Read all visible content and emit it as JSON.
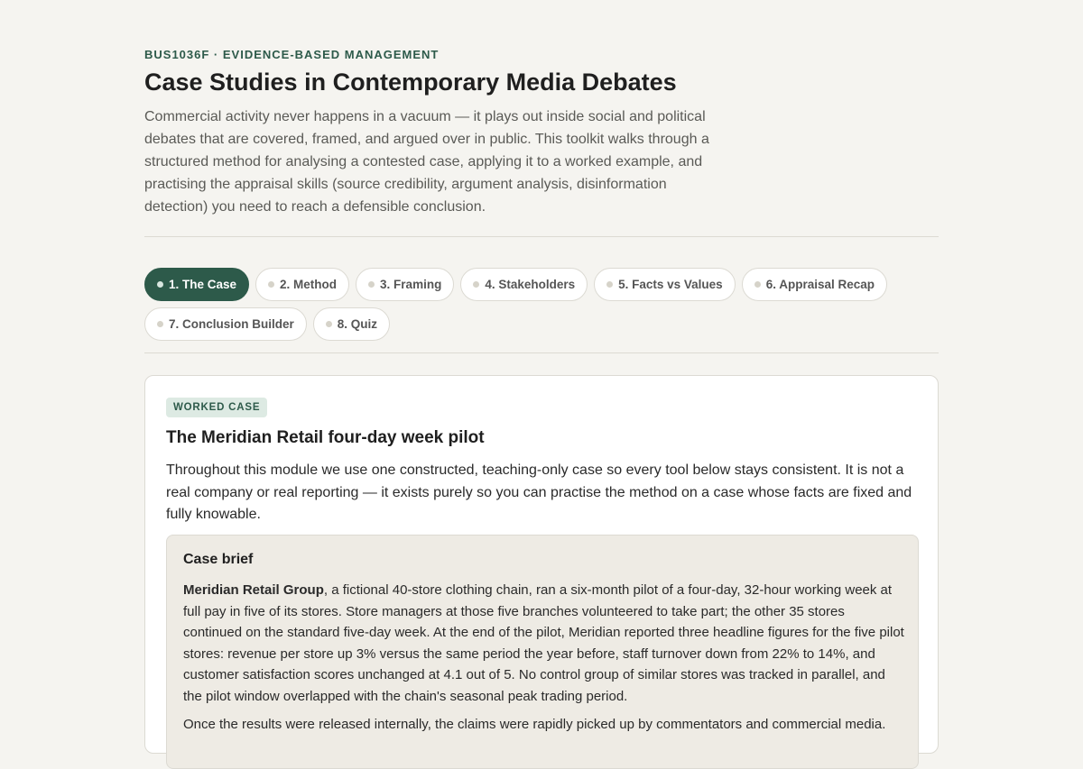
{
  "header": {
    "eyebrow": "BUS1036F · EVIDENCE-BASED MANAGEMENT",
    "title": "Case Studies in Contemporary Media Debates",
    "intro": "Commercial activity never happens in a vacuum — it plays out inside social and political debates that are covered, framed, and argued over in public. This toolkit walks through a structured method for analysing a contested case, applying it to a worked example, and practising the appraisal skills (source credibility, argument analysis, disinformation detection) you need to reach a defensible conclusion."
  },
  "tabs": [
    {
      "label": "1. The Case",
      "active": true
    },
    {
      "label": "2. Method",
      "active": false
    },
    {
      "label": "3. Framing",
      "active": false
    },
    {
      "label": "4. Stakeholders",
      "active": false
    },
    {
      "label": "5. Facts vs Values",
      "active": false
    },
    {
      "label": "6. Appraisal Recap",
      "active": false
    },
    {
      "label": "7. Conclusion Builder",
      "active": false
    },
    {
      "label": "8. Quiz",
      "active": false
    }
  ],
  "case": {
    "badge": "WORKED CASE",
    "title": "The Meridian Retail four-day week pilot",
    "intro": "Throughout this module we use one constructed, teaching-only case so every tool below stays consistent. It is not a real company or real reporting — it exists purely so you can practise the method on a case whose facts are fixed and fully knowable.",
    "brief": {
      "title": "Case brief",
      "company": "Meridian Retail Group",
      "body": ", a fictional 40-store clothing chain, ran a six-month pilot of a four-day, 32-hour working week at full pay in five of its stores. Store managers at those five branches volunteered to take part; the other 35 stores continued on the standard five-day week. At the end of the pilot, Meridian reported three headline figures for the five pilot stores: revenue per store up 3% versus the same period the year before, staff turnover down from 22% to 14%, and customer satisfaction scores unchanged at 4.1 out of 5. No control group of similar stores was tracked in parallel, and the pilot window overlapped with the chain's seasonal peak trading period.",
      "next": "Once the results were released internally, the claims were rapidly picked up by commentators and commercial media."
    }
  },
  "colors": {
    "accent": "#2d5a4a",
    "background": "#f5f4f0",
    "badge_bg": "#ddeae3",
    "brief_bg": "#eeebe4"
  }
}
